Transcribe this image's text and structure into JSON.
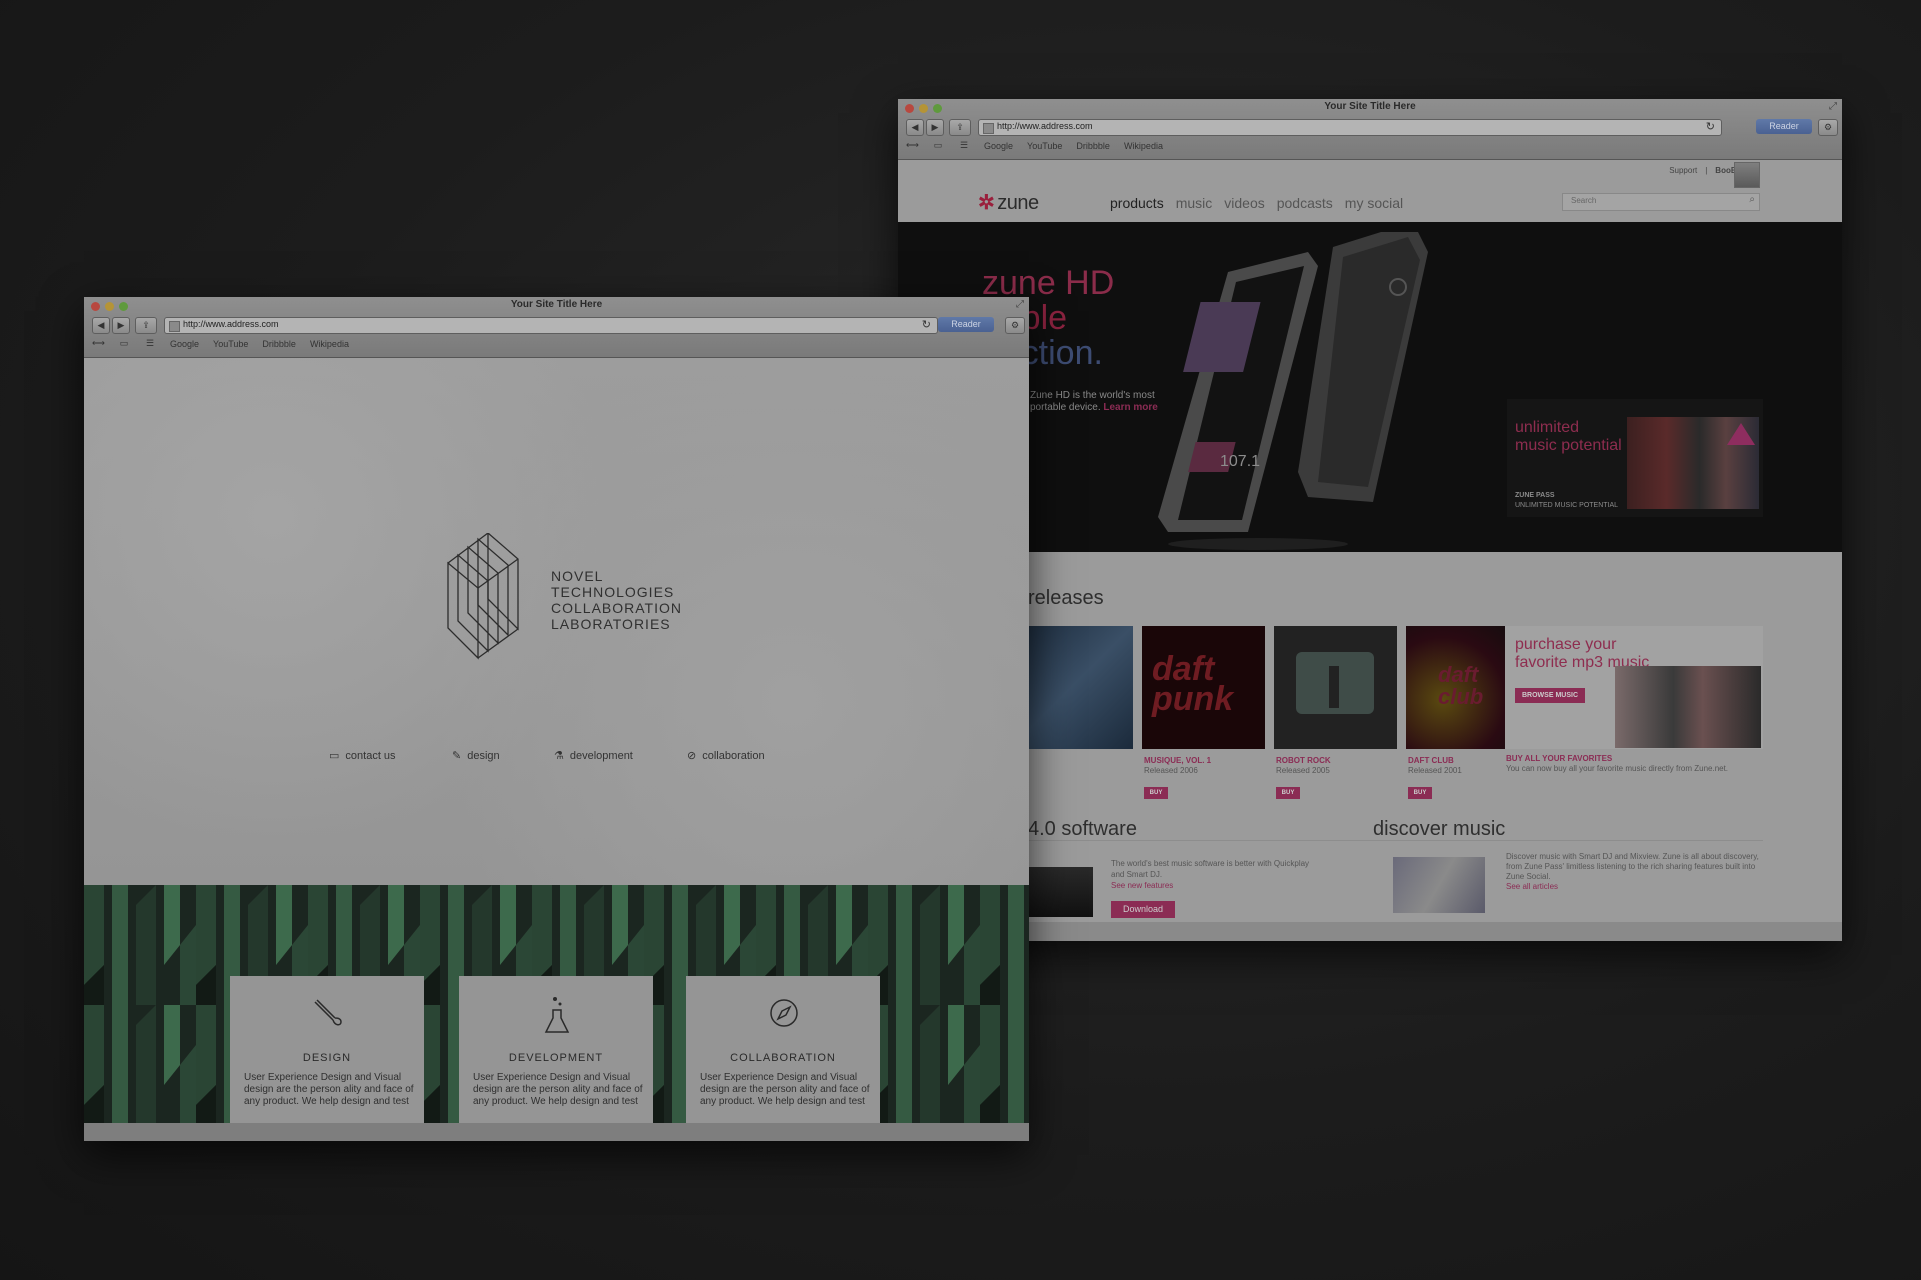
{
  "left_window": {
    "title": "Your Site Title Here",
    "url": "http://www.address.com",
    "reader_label": "Reader",
    "bookmarks": [
      "Google",
      "YouTube",
      "Dribbble",
      "Wikipedia"
    ],
    "logo_lines": [
      "NOVEL",
      "TECHNOLOGIES",
      "COLLABORATION",
      "LABORATORIES"
    ],
    "nav": {
      "contact": "contact us",
      "design": "design",
      "development": "development",
      "collaboration": "collaboration"
    },
    "cards": [
      {
        "title": "DESIGN",
        "body": "User Experience Design and Visual design are the person ality and face of any product. We help design and test"
      },
      {
        "title": "DEVELOPMENT",
        "body": "User Experience Design and Visual design are the person ality and face of any product. We help design and test"
      },
      {
        "title": "COLLABORATION",
        "body": "User Experience Design and Visual design are the person ality and face of any product. We help design and test"
      }
    ]
  },
  "right_window": {
    "title": "Your Site Title Here",
    "url": "http://www.address.com",
    "reader_label": "Reader",
    "bookmarks": [
      "Google",
      "YouTube",
      "Dribbble",
      "Wikipedia"
    ],
    "top_links": {
      "support": "Support",
      "separator": "|",
      "user": "BooBerry ▾"
    },
    "logo_text": "zune",
    "nav": [
      "products",
      "music",
      "videos",
      "podcasts",
      "my social"
    ],
    "search_placeholder": "Search",
    "hero": {
      "lines": [
        "zune HD",
        "rtable",
        "rfection."
      ],
      "desc1": "Zune HD is the world's most",
      "desc2": "portable device.",
      "learn_more": "Learn more"
    },
    "zune_pass": {
      "title_line1": "unlimited",
      "title_line2": "music potential",
      "label1": "ZUNE PASS",
      "label2": "UNLIMITED MUSIC POTENTIAL"
    },
    "new_releases": "releases",
    "albums": [
      {
        "title": "MUSIQUE, VOL. 1",
        "released": "Released 2006",
        "buy": "BUY"
      },
      {
        "title": "ROBOT ROCK",
        "released": "Released 2005",
        "buy": "BUY"
      },
      {
        "title": "DAFT CLUB",
        "released": "Released 2001",
        "buy": "BUY"
      }
    ],
    "promo": {
      "line1": "purchase your",
      "line2": "favorite mp3 music",
      "button": "BROWSE MUSIC",
      "heading": "BUY ALL YOUR FAVORITES",
      "body": "You can now buy all your favorite music directly from Zune.net."
    },
    "software": {
      "heading": "4.0 software",
      "body": "The world's best music software is better with Quickplay and Smart DJ.",
      "link": "See new features",
      "button": "Download"
    },
    "discover": {
      "heading": "discover music",
      "body": "Discover music with Smart DJ and Mixview. Zune is all about discovery, from Zune Pass' limitless listening to the rich sharing features built into Zune Social.",
      "link": "See all articles"
    }
  },
  "colors": {
    "background": "#1c1c1c",
    "zune_magenta": "#8b2c54",
    "reader_blue": "#4a6192",
    "pattern_green": "#1d2a22"
  }
}
